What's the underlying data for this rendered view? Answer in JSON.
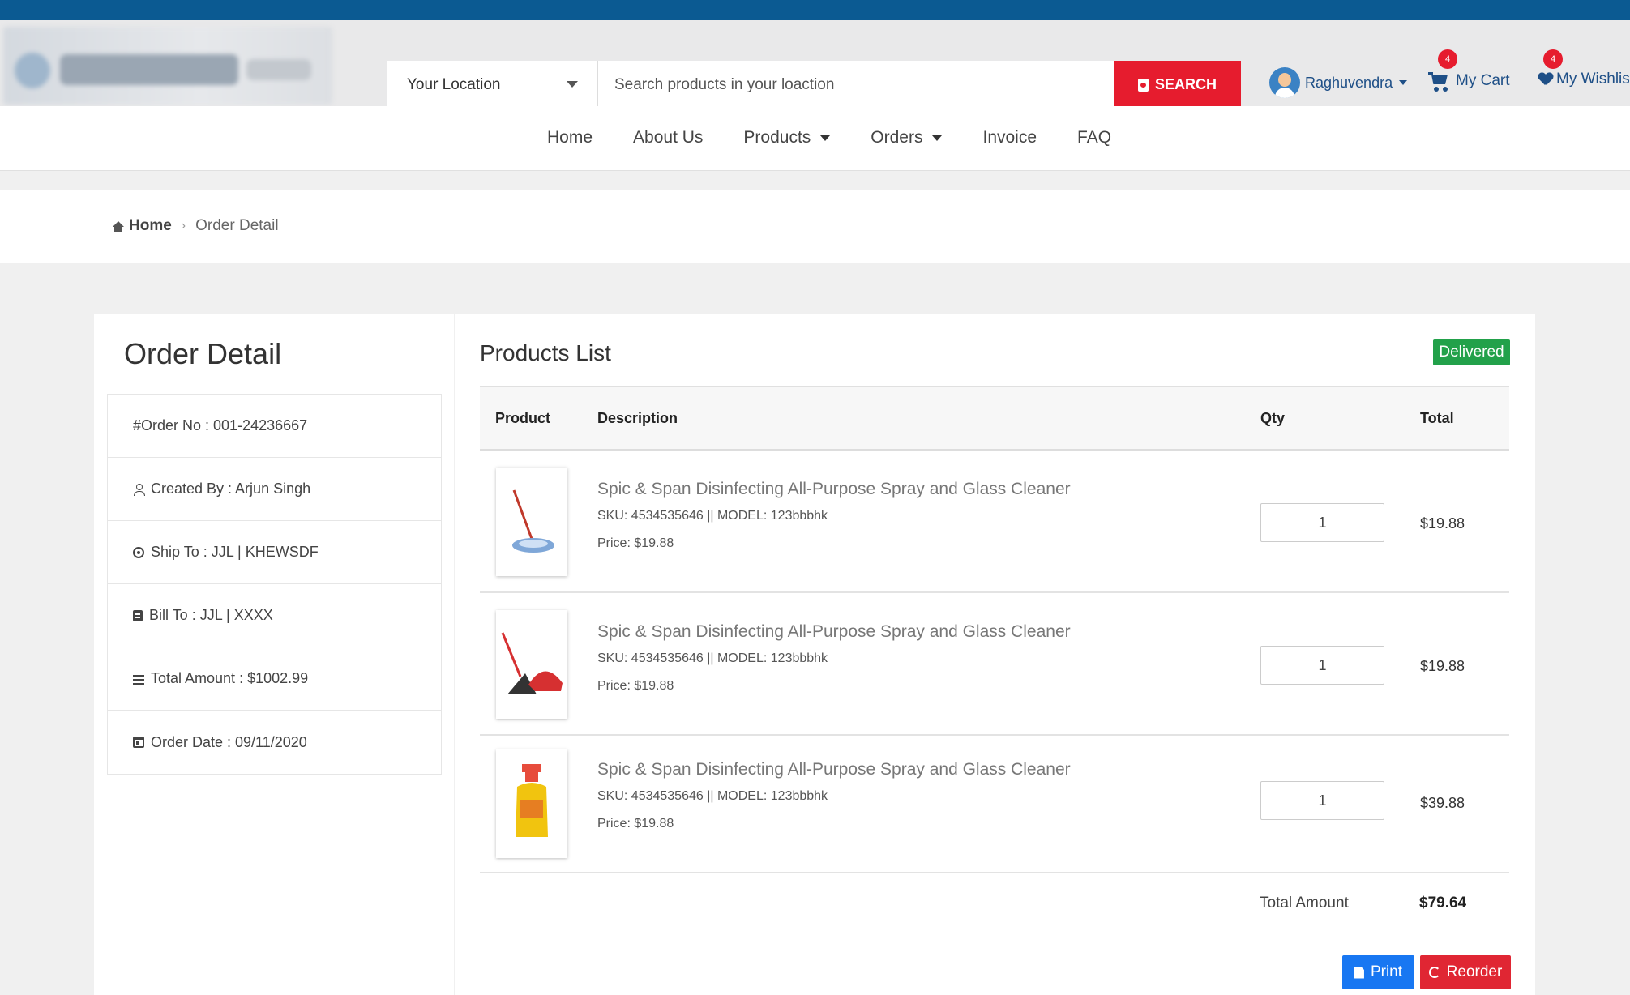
{
  "header": {
    "location_label": "Your Location",
    "search_placeholder": "Search products in your loaction",
    "search_button": "SEARCH",
    "user_name": "Raghuvendra",
    "cart_label": "My Cart",
    "cart_count": "4",
    "wishlist_label": "My Wishlis",
    "wishlist_count": "4"
  },
  "nav": {
    "items": [
      {
        "label": "Home"
      },
      {
        "label": "About Us"
      },
      {
        "label": "Products"
      },
      {
        "label": "Orders"
      },
      {
        "label": "Invoice"
      },
      {
        "label": "FAQ"
      }
    ]
  },
  "breadcrumb": {
    "home": "Home",
    "current": "Order Detail"
  },
  "order": {
    "title": "Order Detail",
    "order_no": "#Order No : 001-24236667",
    "created_by": "Created By : Arjun Singh",
    "ship_to": "Ship To : JJL | KHEWSDF",
    "bill_to": "Bill To : JJL | XXXX",
    "total_amount": "Total Amount : $1002.99",
    "order_date": "Order Date : 09/11/2020"
  },
  "products": {
    "title": "Products List",
    "status": "Delivered",
    "columns": {
      "product": "Product",
      "description": "Description",
      "qty": "Qty",
      "total": "Total"
    },
    "rows": [
      {
        "name": "Spic & Span Disinfecting All-Purpose Spray and Glass Cleaner",
        "sku": "SKU: 4534535646 || MODEL: 123bbbhk",
        "price": "Price: $19.88",
        "qty": "1",
        "total": "$19.88",
        "thumb": "mop-icon"
      },
      {
        "name": "Spic & Span Disinfecting All-Purpose Spray and Glass Cleaner",
        "sku": "SKU: 4534535646 || MODEL: 123bbbhk",
        "price": "Price: $19.88",
        "qty": "1",
        "total": "$19.88",
        "thumb": "broom-dustpan-icon"
      },
      {
        "name": "Spic & Span Disinfecting All-Purpose Spray and Glass Cleaner",
        "sku": "SKU: 4534535646 || MODEL: 123bbbhk",
        "price": "Price: $19.88",
        "qty": "1",
        "total": "$39.88",
        "thumb": "spray-bottle-icon"
      }
    ],
    "total_label": "Total Amount",
    "total_value": "$79.64",
    "print_label": "Print",
    "reorder_label": "Reorder"
  },
  "colors": {
    "brand_blue": "#0b5a92",
    "search_red": "#e61c2e",
    "delivered_green": "#22a14a",
    "print_blue": "#1877f2",
    "reorder_red": "#e02633"
  }
}
